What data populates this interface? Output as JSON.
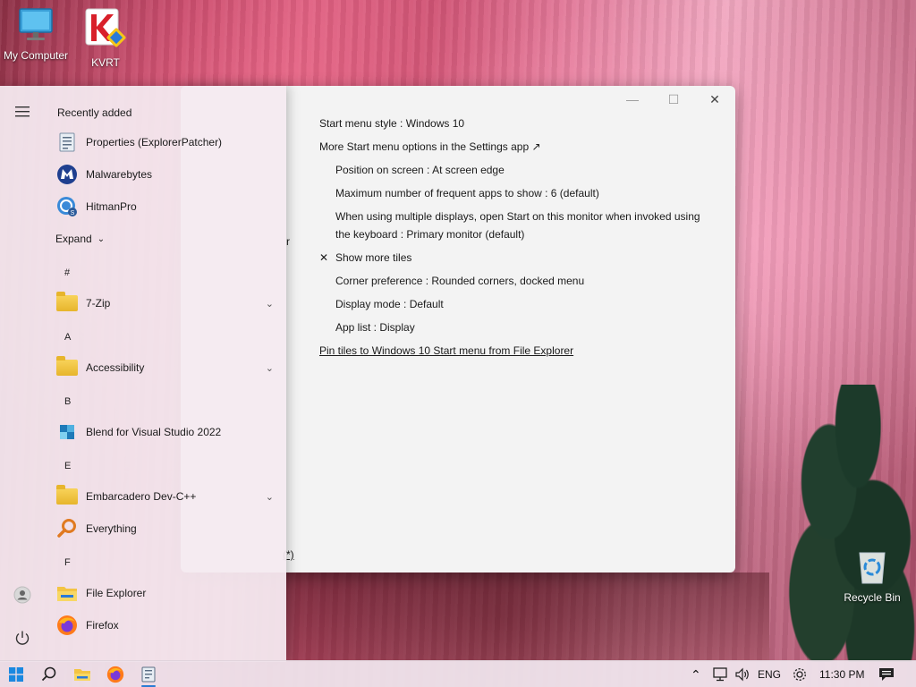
{
  "desktop": {
    "icons": [
      {
        "label": "My Computer",
        "icon": "monitor-icon"
      },
      {
        "label": "KVRT",
        "icon": "kaspersky-icon"
      },
      {
        "label": "Recycle Bin",
        "icon": "recycle-bin-icon"
      }
    ]
  },
  "settings_window": {
    "controls": {
      "minimize": "—",
      "maximize": "☐",
      "close": "✕"
    },
    "options": [
      {
        "label": "Start menu style : Windows 10",
        "indent": false
      },
      {
        "label": "More Start menu options in the Settings app ↗",
        "indent": false
      },
      {
        "label": "Position on screen : At screen edge",
        "indent": true
      },
      {
        "label": "Maximum number of frequent apps to show : 6 (default)",
        "indent": true
      },
      {
        "label": "When using multiple displays, open Start on this monitor when invoked using",
        "indent": true
      },
      {
        "label": "the keyboard : Primary monitor (default)",
        "indent": true
      },
      {
        "label": "Show more tiles",
        "indent": true,
        "checked": true
      },
      {
        "label": "Corner preference : Rounded corners, docked menu",
        "indent": true
      },
      {
        "label": "Display mode : Default",
        "indent": true
      },
      {
        "label": "App list : Display",
        "indent": true
      },
      {
        "label": "Pin tiles to Windows 10 Start menu from File Explorer",
        "indent": false,
        "link": true
      }
    ],
    "check_mark": "✕",
    "fragment_r": "r",
    "fragment_star": " (*)"
  },
  "start_menu": {
    "recently_added_label": "Recently added",
    "expand_label": "Expand",
    "recent": [
      {
        "label": "Properties (ExplorerPatcher)",
        "icon": "properties-icon"
      },
      {
        "label": "Malwarebytes",
        "icon": "malwarebytes-icon"
      },
      {
        "label": "HitmanPro",
        "icon": "hitmanpro-icon"
      }
    ],
    "letters": {
      "hash": "#",
      "a": "A",
      "b": "B",
      "e": "E",
      "f": "F"
    },
    "apps": [
      {
        "label": "7-Zip",
        "icon": "folder-icon",
        "expandable": true
      },
      {
        "label": "Accessibility",
        "icon": "folder-icon",
        "expandable": true
      },
      {
        "label": "Blend for Visual Studio 2022",
        "icon": "blend-icon",
        "expandable": false
      },
      {
        "label": "Embarcadero Dev-C++",
        "icon": "folder-icon",
        "expandable": true
      },
      {
        "label": "Everything",
        "icon": "everything-search-icon",
        "expandable": false
      },
      {
        "label": "File Explorer",
        "icon": "file-explorer-icon",
        "expandable": false
      },
      {
        "label": "Firefox",
        "icon": "firefox-icon",
        "expandable": false
      }
    ]
  },
  "taskbar": {
    "language": "ENG",
    "time": "11:30 PM"
  }
}
